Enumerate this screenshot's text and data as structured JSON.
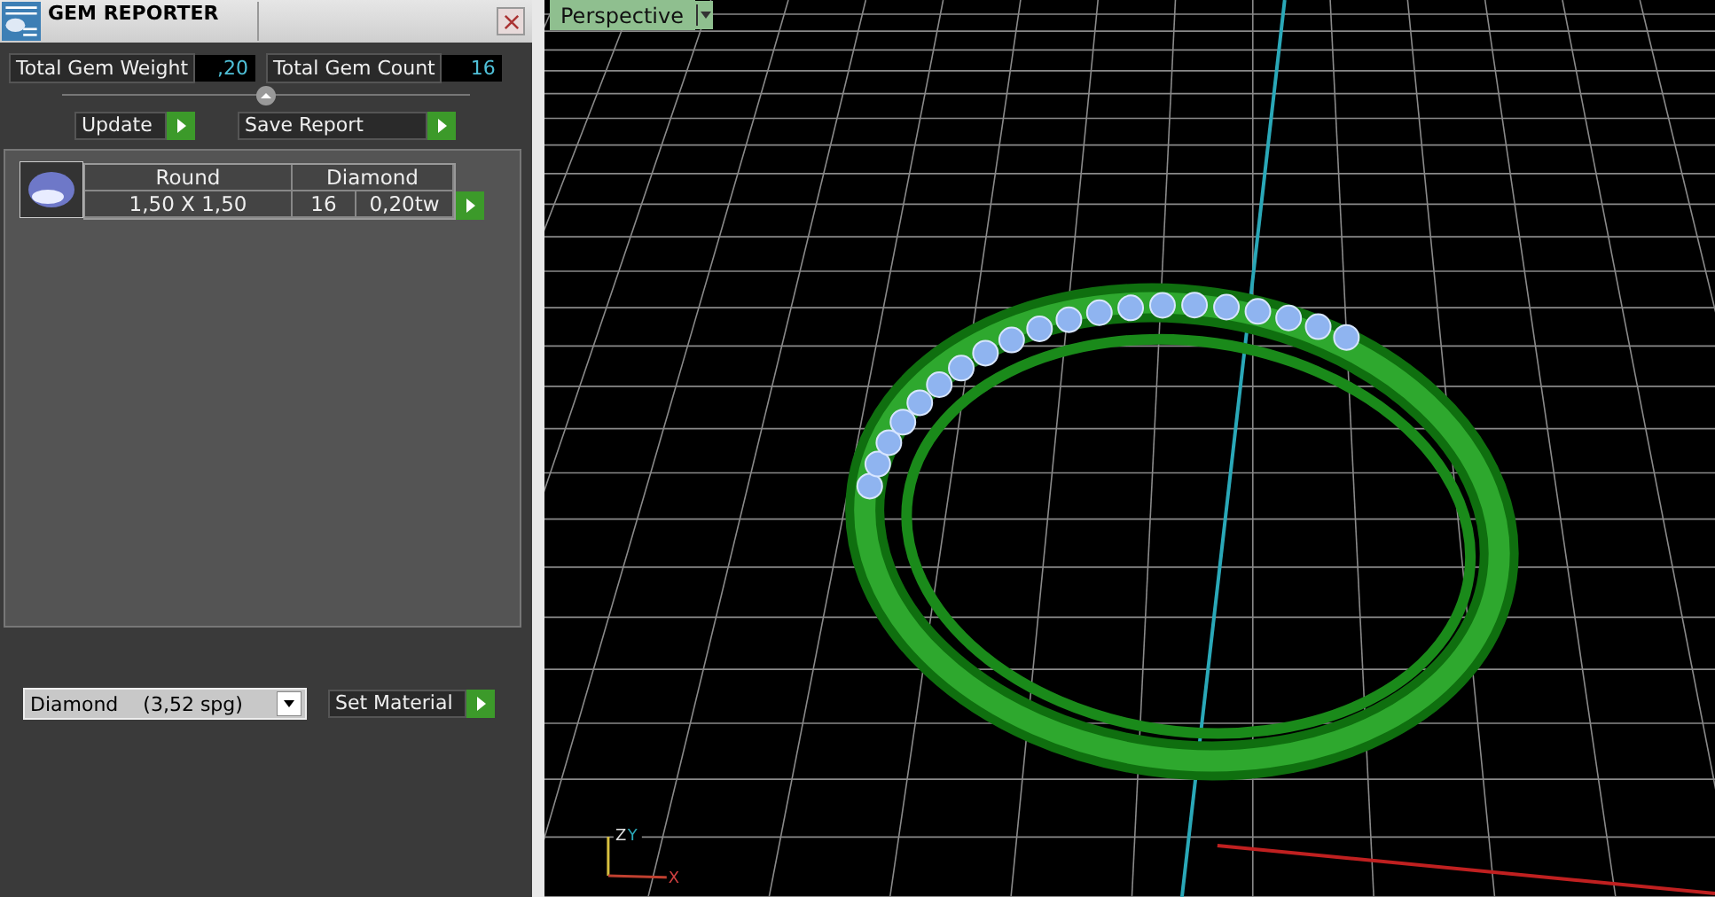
{
  "panel": {
    "title": "GEM REPORTER",
    "stats": [
      {
        "label": "Total Gem Weight",
        "value": ",20"
      },
      {
        "label": "Total Gem Count",
        "value": "16"
      }
    ],
    "buttons": [
      "Update",
      "Save Report"
    ],
    "gems": [
      {
        "shape": "Round",
        "material": "Diamond",
        "size": "1,50 X 1,50",
        "count": "16",
        "weight": "0,20tw"
      }
    ],
    "material_select": {
      "value": "Diamond",
      "density": "(3,52 spg)"
    },
    "set_button": "Set Material"
  },
  "viewport": {
    "view_label": "Perspective",
    "axis_labels": [
      "Z",
      "Y",
      "X"
    ]
  }
}
